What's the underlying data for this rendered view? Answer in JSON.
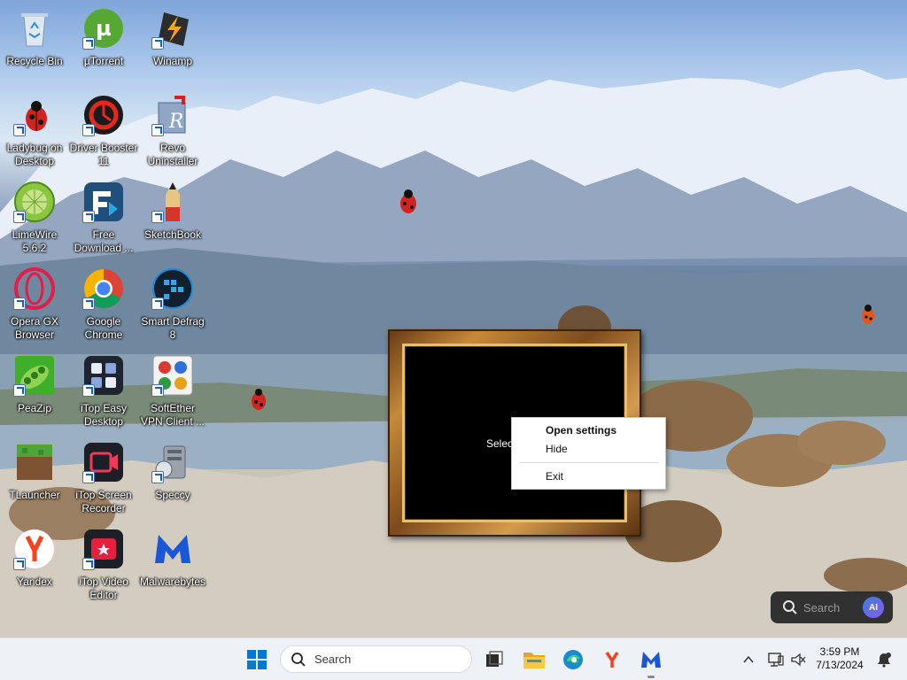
{
  "desktop": {
    "icons": [
      {
        "label": "Recycle Bin",
        "icon": "recycle-bin-icon"
      },
      {
        "label": "µTorrent",
        "icon": "utorrent-icon"
      },
      {
        "label": "Winamp",
        "icon": "winamp-icon"
      },
      {
        "label": "Ladybug on Desktop",
        "icon": "ladybug-icon"
      },
      {
        "label": "Driver Booster 11",
        "icon": "driver-booster-icon"
      },
      {
        "label": "Revo Uninstaller",
        "icon": "revo-uninstaller-icon"
      },
      {
        "label": "LimeWire 5.6.2",
        "icon": "limewire-icon"
      },
      {
        "label": "Free Download ...",
        "icon": "free-download-icon"
      },
      {
        "label": "SketchBook",
        "icon": "sketchbook-icon"
      },
      {
        "label": "Opera GX Browser",
        "icon": "opera-gx-icon"
      },
      {
        "label": "Google Chrome",
        "icon": "chrome-icon"
      },
      {
        "label": "Smart Defrag 8",
        "icon": "smart-defrag-icon"
      },
      {
        "label": "PeaZip",
        "icon": "peazip-icon"
      },
      {
        "label": "iTop Easy Desktop",
        "icon": "itop-easy-desktop-icon"
      },
      {
        "label": "SoftEther VPN Client ...",
        "icon": "softether-vpn-icon"
      },
      {
        "label": "TLauncher",
        "icon": "tlauncher-icon"
      },
      {
        "label": "iTop Screen Recorder",
        "icon": "itop-screen-recorder-icon"
      },
      {
        "label": "Speccy",
        "icon": "speccy-icon"
      },
      {
        "label": "Yandex",
        "icon": "yandex-icon"
      },
      {
        "label": "iTop Video Editor",
        "icon": "itop-video-editor-icon"
      },
      {
        "label": "Malwarebytes",
        "icon": "malwarebytes-icon"
      }
    ]
  },
  "frame_widget": {
    "text": "Selec"
  },
  "context_menu": {
    "items": [
      {
        "label": "Open settings",
        "bold": true
      },
      {
        "label": "Hide",
        "bold": false
      },
      {
        "label": "Exit",
        "bold": false
      }
    ]
  },
  "floating_search": {
    "placeholder": "Search",
    "badge": "AI"
  },
  "taskbar": {
    "search_placeholder": "Search",
    "pinned": [
      "start-icon",
      "task-view-icon",
      "file-explorer-icon",
      "edge-icon",
      "yandex-icon",
      "malwarebytes-icon"
    ],
    "tray": {
      "time": "3:59 PM",
      "date": "7/13/2024"
    }
  },
  "colors": {
    "taskbar": "#eef1f6",
    "accent": "#0067c0",
    "menu_bg": "#ffffff"
  }
}
